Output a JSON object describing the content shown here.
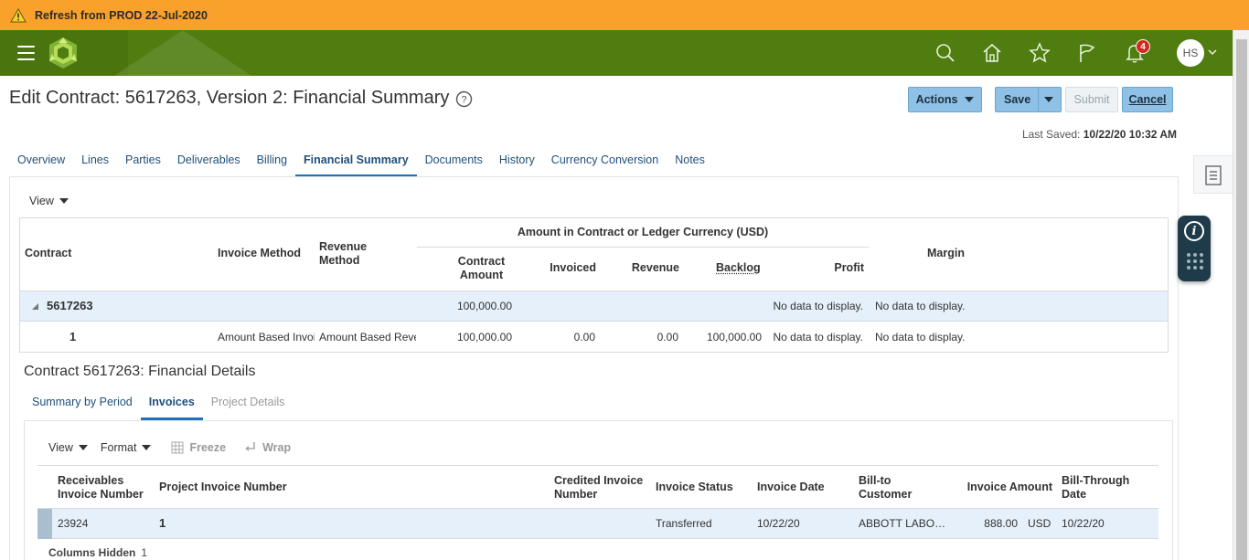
{
  "banner": {
    "text": "Refresh from PROD 22-Jul-2020"
  },
  "header": {
    "icons": [
      "search-icon",
      "home-icon",
      "favorites-star-icon",
      "flag-icon",
      "notifications-bell-icon"
    ],
    "notification_count": "4",
    "user_initials": "HS",
    "colors": {
      "banner": "#f9a12a",
      "header": "#4f7d0f",
      "button": "#8fc1e7"
    }
  },
  "page": {
    "title": "Edit Contract: 5617263, Version 2: Financial Summary",
    "actions_label": "Actions",
    "save_label": "Save",
    "submit_label": "Submit",
    "cancel_label": "Cancel",
    "last_saved_label": "Last Saved:",
    "last_saved_value": "10/22/20 10:32 AM"
  },
  "tabs": [
    {
      "label": "Overview"
    },
    {
      "label": "Lines"
    },
    {
      "label": "Parties"
    },
    {
      "label": "Deliverables"
    },
    {
      "label": "Billing"
    },
    {
      "label": "Financial Summary"
    },
    {
      "label": "Documents"
    },
    {
      "label": "History"
    },
    {
      "label": "Currency Conversion"
    },
    {
      "label": "Notes"
    }
  ],
  "summary": {
    "view_label": "View",
    "headers": {
      "contract": "Contract",
      "invoice_method": "Invoice Method",
      "revenue_method": "Revenue Method",
      "group": "Amount in Contract or Ledger Currency (USD)",
      "contract_amount": "Contract Amount",
      "invoiced": "Invoiced",
      "revenue": "Revenue",
      "backlog": "Backlog",
      "profit": "Profit",
      "margin": "Margin"
    },
    "rows": [
      {
        "contract": "5617263",
        "invoice_method": "",
        "revenue_method": "",
        "contract_amount": "100,000.00",
        "invoiced": "",
        "revenue": "",
        "backlog": "",
        "profit": "No data to display.",
        "margin": "No data to display."
      },
      {
        "contract": "1",
        "invoice_method": "Amount Based Invoice",
        "revenue_method": "Amount Based Revenue",
        "contract_amount": "100,000.00",
        "invoiced": "0.00",
        "revenue": "0.00",
        "backlog": "100,000.00",
        "profit": "No data to display.",
        "margin": "No data to display."
      }
    ]
  },
  "details": {
    "title": "Contract 5617263: Financial Details",
    "subtabs": [
      {
        "label": "Summary by Period"
      },
      {
        "label": "Invoices"
      },
      {
        "label": "Project Details"
      }
    ],
    "toolbar": {
      "view": "View",
      "format": "Format",
      "freeze": "Freeze",
      "wrap": "Wrap"
    },
    "headers": {
      "receivables_invoice_number": "Receivables Invoice Number",
      "project_invoice_number": "Project Invoice Number",
      "credited_invoice_number": "Credited Invoice Number",
      "invoice_status": "Invoice Status",
      "invoice_date": "Invoice Date",
      "bill_to_customer": "Bill-to Customer",
      "invoice_amount": "Invoice Amount",
      "bill_through_date": "Bill-Through Date"
    },
    "rows": [
      {
        "receivables_invoice_number": "23924",
        "project_invoice_number": "1",
        "credited_invoice_number": "",
        "invoice_status": "Transferred",
        "invoice_date": "10/22/20",
        "bill_to_customer": "ABBOTT LABO…",
        "invoice_amount": "888.00",
        "currency": "USD",
        "bill_through_date": "10/22/20"
      }
    ],
    "columns_hidden_label": "Columns Hidden",
    "columns_hidden_count": "1"
  }
}
